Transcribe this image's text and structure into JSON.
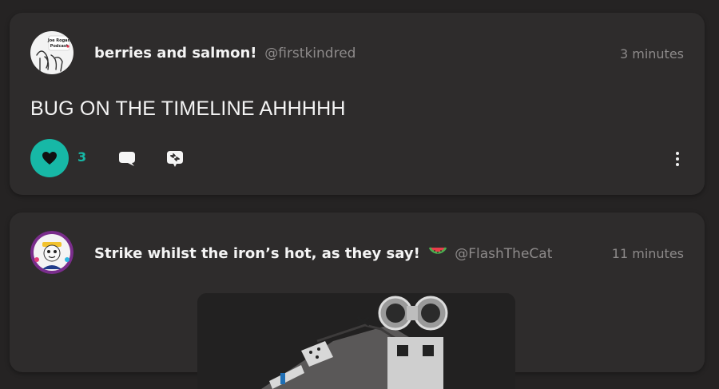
{
  "posts": [
    {
      "display_name": "berries and salmon!",
      "handle": "@firstkindred",
      "time": "3 minutes",
      "text": "BUG ON THE TIMELINE AHHHHH",
      "like_count": "3",
      "avatar_lettering": "Joe Rogan Podcast",
      "avatar_icon": "podcast-avatar"
    },
    {
      "display_name": "Strike whilst the iron’s hot, as they say!",
      "handle": "@FlashTheCat",
      "time": "11 minutes",
      "emoji": "watermelon-icon",
      "avatar_icon": "cartoon-character-avatar",
      "media_icon": "robot-figure-image"
    }
  ],
  "colors": {
    "background": "#252323",
    "card": "#2e2c2c",
    "accent": "#17b8a6",
    "muted_text": "#8d8a8a"
  },
  "icons": {
    "like": "heart-icon",
    "comment": "speech-bubble-icon",
    "share": "reblog-icon",
    "more": "more-vertical-icon"
  }
}
